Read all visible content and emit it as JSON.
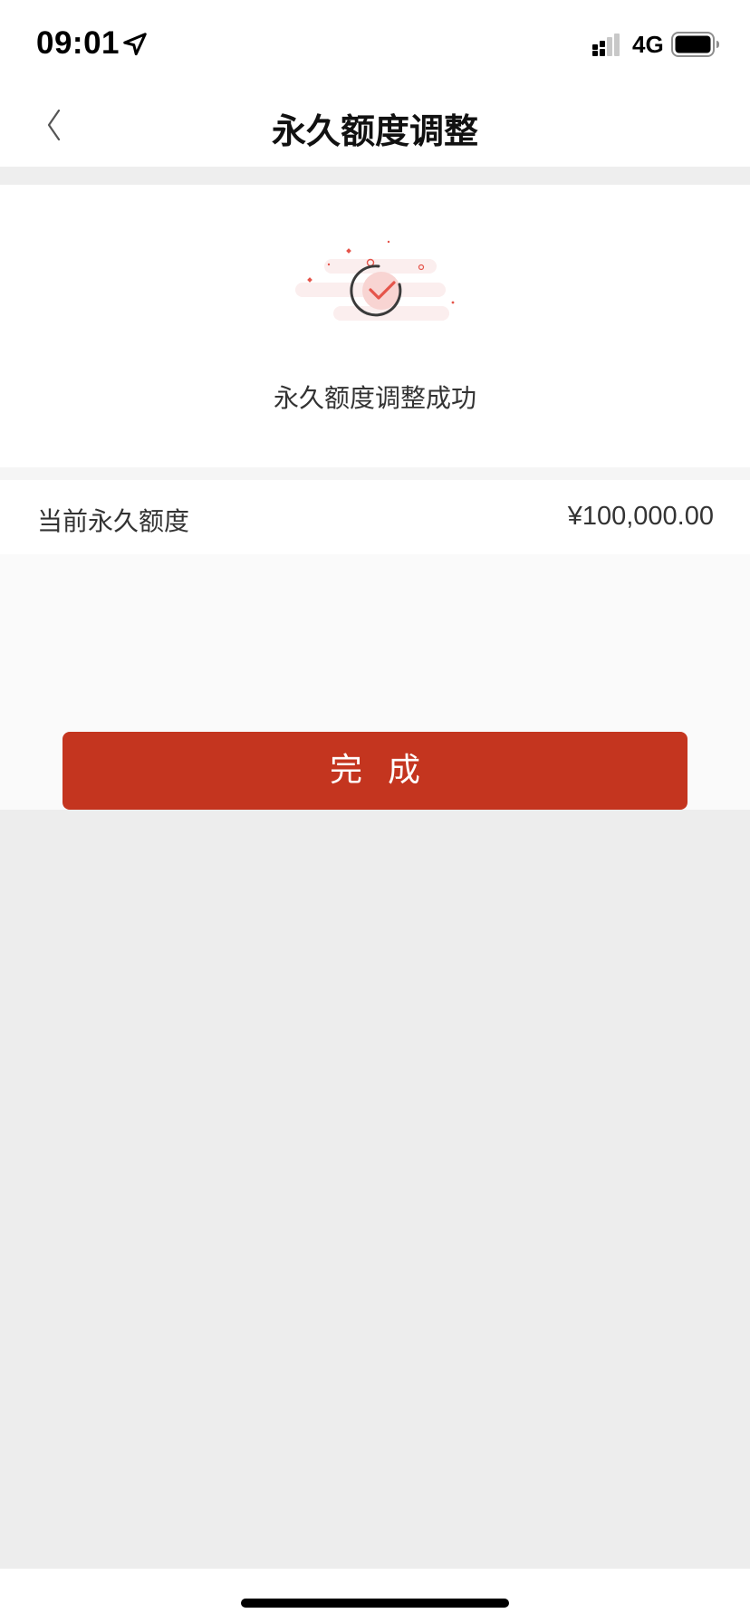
{
  "status_bar": {
    "time": "09:01",
    "network": "4G",
    "icons": [
      "location-arrow-icon",
      "signal-icon",
      "battery-icon"
    ]
  },
  "nav": {
    "title": "永久额度调整",
    "back_icon": "chevron-left-icon"
  },
  "success": {
    "icon": "success-check-icon",
    "message": "永久额度调整成功"
  },
  "limit": {
    "label": "当前永久额度",
    "value": "¥100,000.00"
  },
  "actions": {
    "done_label": "完成"
  },
  "colors": {
    "accent": "#c4351f",
    "page_background": "#ededed",
    "card_background": "#ffffff"
  }
}
